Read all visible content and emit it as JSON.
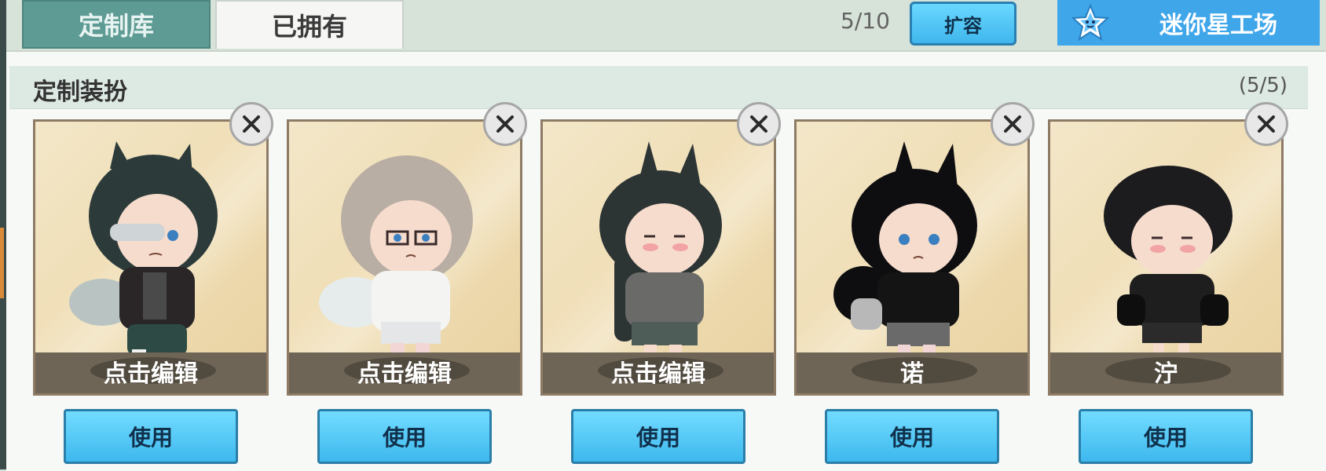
{
  "tabs": [
    {
      "label": "定制库",
      "active": false
    },
    {
      "label": "已拥有",
      "active": true
    }
  ],
  "capacity": {
    "value": "5/10"
  },
  "expand_label": "扩容",
  "workshop_label": "迷你星工场",
  "section": {
    "title": "定制装扮",
    "count": "(5/5)"
  },
  "outfits": [
    {
      "name": "点击编辑",
      "use_label": "使用",
      "hair": "#2c3b3a",
      "top": "#2a2628",
      "icon": "close-icon"
    },
    {
      "name": "点击编辑",
      "use_label": "使用",
      "hair": "#b9aea4",
      "top": "#f4f4f2",
      "icon": "close-icon"
    },
    {
      "name": "点击编辑",
      "use_label": "使用",
      "hair": "#2d3434",
      "top": "#6a6a68",
      "icon": "close-icon"
    },
    {
      "name": "诺",
      "use_label": "使用",
      "hair": "#0e0e10",
      "top": "#141414",
      "icon": "close-icon"
    },
    {
      "name": "泞",
      "use_label": "使用",
      "hair": "#1c1c1e",
      "top": "#1e1e1e",
      "icon": "close-icon"
    }
  ],
  "colors": {
    "tab_active_bg": "#f6f7f4",
    "tab_inactive_bg": "#5e9b94",
    "button_blue": "#3eb8ee",
    "card_bg": "#efdcb1"
  }
}
